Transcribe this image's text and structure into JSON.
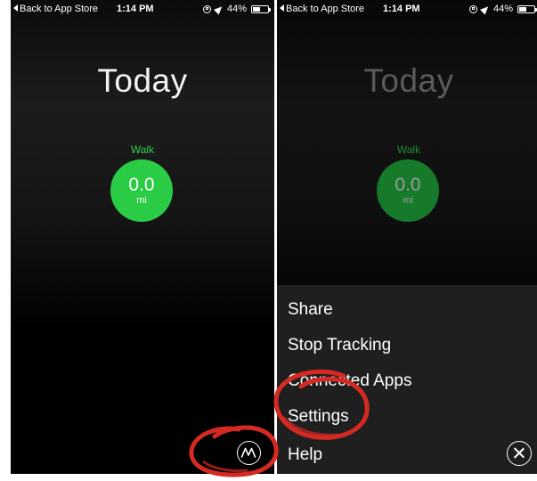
{
  "left_screen": {
    "status_bar": {
      "back_label": "Back to App Store",
      "time": "1:14 PM",
      "battery": "44%"
    },
    "title": "Today",
    "activity": {
      "label": "Walk",
      "value": "0.0",
      "unit": "mi"
    },
    "menu_icon": "moves-logo-icon"
  },
  "right_screen": {
    "status_bar": {
      "back_label": "Back to App Store",
      "time": "1:14 PM",
      "battery": "44%"
    },
    "title": "Today",
    "activity": {
      "label": "Walk",
      "value": "0.0",
      "unit": "mi"
    },
    "menu": {
      "items": [
        "Share",
        "Stop Tracking",
        "Connected Apps",
        "Settings",
        "Help"
      ],
      "close_icon": "close-icon"
    }
  },
  "annotation_color": "#d42a22"
}
